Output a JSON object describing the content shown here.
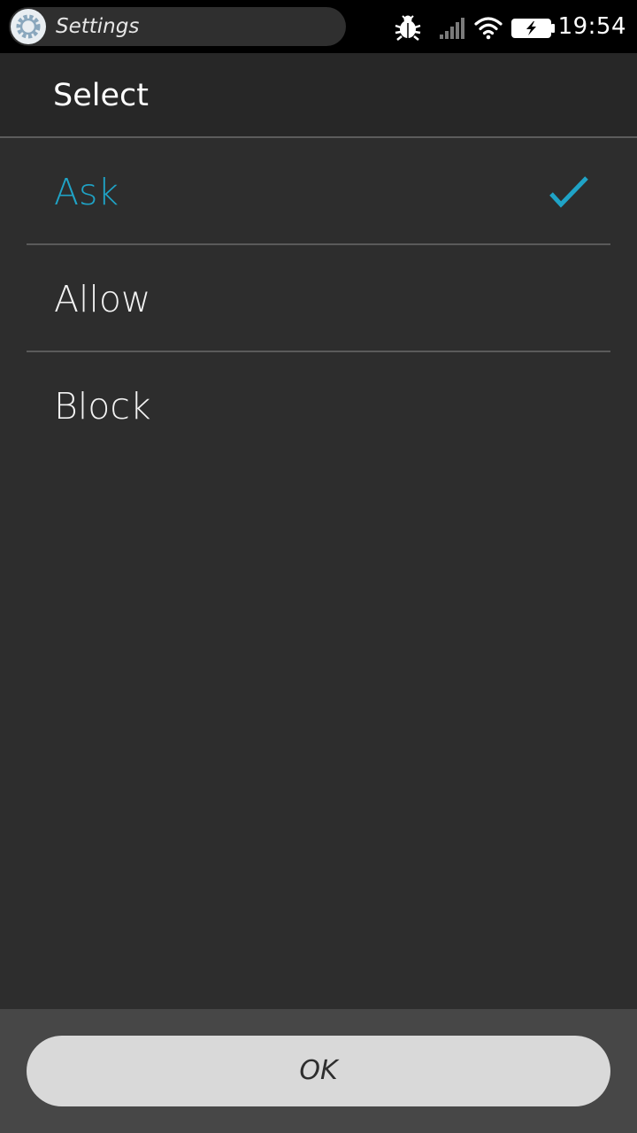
{
  "status_bar": {
    "app_title": "Settings",
    "time": "19:54",
    "icons": [
      "settings-gear-icon",
      "debug-bug-icon",
      "signal-strength-icon",
      "wifi-icon",
      "battery-charging-icon"
    ]
  },
  "dialog": {
    "title": "Select",
    "options": [
      {
        "label": "Ask",
        "selected": true
      },
      {
        "label": "Allow",
        "selected": false
      },
      {
        "label": "Block",
        "selected": false
      }
    ],
    "ok_label": "OK"
  },
  "colors": {
    "accent": "#1fa3c6",
    "background": "#2d2d2d",
    "header_background": "#272727",
    "footer_background": "#474747",
    "button_background": "#d9d9d9"
  }
}
